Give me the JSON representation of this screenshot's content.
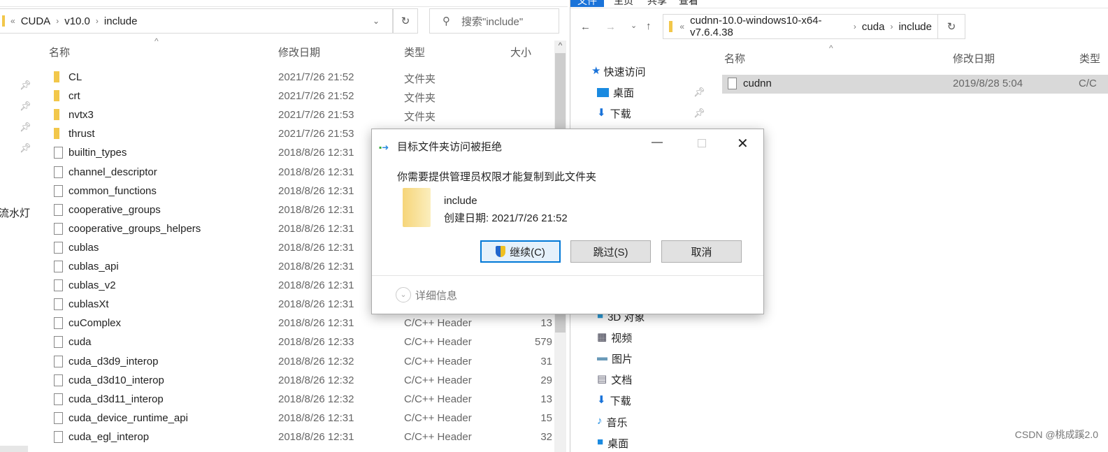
{
  "left": {
    "breadcrumb": [
      "CUDA",
      "v10.0",
      "include"
    ],
    "search_placeholder": "搜索\"include\"",
    "columns": {
      "name": "名称",
      "date": "修改日期",
      "type": "类型",
      "size": "大小"
    },
    "sidebar_label": "流水灯",
    "rows": [
      {
        "name": "CL",
        "date": "2021/7/26 21:52",
        "type": "文件夹",
        "size": "",
        "kind": "folder"
      },
      {
        "name": "crt",
        "date": "2021/7/26 21:52",
        "type": "文件夹",
        "size": "",
        "kind": "folder"
      },
      {
        "name": "nvtx3",
        "date": "2021/7/26 21:53",
        "type": "文件夹",
        "size": "",
        "kind": "folder"
      },
      {
        "name": "thrust",
        "date": "2021/7/26 21:53",
        "type": "",
        "size": "",
        "kind": "folder"
      },
      {
        "name": "builtin_types",
        "date": "2018/8/26 12:31",
        "type": "",
        "size": "",
        "kind": "file"
      },
      {
        "name": "channel_descriptor",
        "date": "2018/8/26 12:31",
        "type": "",
        "size": "",
        "kind": "file"
      },
      {
        "name": "common_functions",
        "date": "2018/8/26 12:31",
        "type": "",
        "size": "",
        "kind": "file"
      },
      {
        "name": "cooperative_groups",
        "date": "2018/8/26 12:31",
        "type": "",
        "size": "",
        "kind": "file"
      },
      {
        "name": "cooperative_groups_helpers",
        "date": "2018/8/26 12:31",
        "type": "",
        "size": "",
        "kind": "file"
      },
      {
        "name": "cublas",
        "date": "2018/8/26 12:31",
        "type": "",
        "size": "",
        "kind": "file"
      },
      {
        "name": "cublas_api",
        "date": "2018/8/26 12:31",
        "type": "",
        "size": "",
        "kind": "file"
      },
      {
        "name": "cublas_v2",
        "date": "2018/8/26 12:31",
        "type": "",
        "size": "",
        "kind": "file"
      },
      {
        "name": "cublasXt",
        "date": "2018/8/26 12:31",
        "type": "",
        "size": "",
        "kind": "file"
      },
      {
        "name": "cuComplex",
        "date": "2018/8/26 12:31",
        "type": "C/C++ Header",
        "size": "13",
        "kind": "file"
      },
      {
        "name": "cuda",
        "date": "2018/8/26 12:33",
        "type": "C/C++ Header",
        "size": "579",
        "kind": "file"
      },
      {
        "name": "cuda_d3d9_interop",
        "date": "2018/8/26 12:32",
        "type": "C/C++ Header",
        "size": "31",
        "kind": "file"
      },
      {
        "name": "cuda_d3d10_interop",
        "date": "2018/8/26 12:32",
        "type": "C/C++ Header",
        "size": "29",
        "kind": "file"
      },
      {
        "name": "cuda_d3d11_interop",
        "date": "2018/8/26 12:32",
        "type": "C/C++ Header",
        "size": "13",
        "kind": "file"
      },
      {
        "name": "cuda_device_runtime_api",
        "date": "2018/8/26 12:31",
        "type": "C/C++ Header",
        "size": "15",
        "kind": "file"
      },
      {
        "name": "cuda_egl_interop",
        "date": "2018/8/26 12:31",
        "type": "C/C++ Header",
        "size": "32",
        "kind": "file"
      }
    ]
  },
  "right": {
    "ribbon_tabs": [
      "文件",
      "主页",
      "共享",
      "查看"
    ],
    "breadcrumb": [
      "cudnn-10.0-windows10-x64-v7.6.4.38",
      "cuda",
      "include"
    ],
    "columns": {
      "name": "名称",
      "date": "修改日期",
      "type": "类型"
    },
    "rows": [
      {
        "name": "cudnn",
        "date": "2019/8/28 5:04",
        "type": "C/C"
      }
    ],
    "nav_top": [
      "快速访问",
      "桌面",
      "下载"
    ],
    "nav_bottom": [
      "3D 对象",
      "视频",
      "图片",
      "文档",
      "下载",
      "音乐",
      "桌面"
    ]
  },
  "dialog": {
    "title": "目标文件夹访问被拒绝",
    "message": "你需要提供管理员权限才能复制到此文件夹",
    "item_name": "include",
    "item_created": "创建日期: 2021/7/26 21:52",
    "continue": "继续(C)",
    "skip": "跳过(S)",
    "cancel": "取消",
    "details": "详细信息"
  },
  "watermark": "CSDN @桃成蹊2.0",
  "colors": {
    "accent": "#1a73d9",
    "folder": "#f2c74a",
    "selection": "#d9d9d9"
  }
}
